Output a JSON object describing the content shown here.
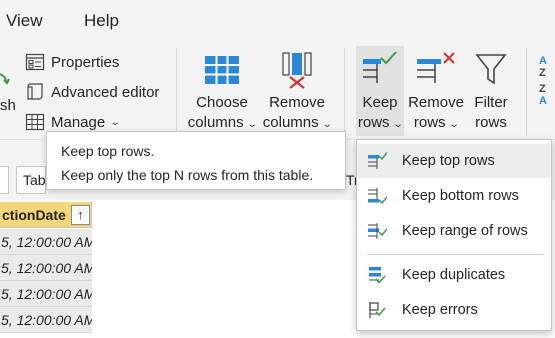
{
  "menu": {
    "view": "View",
    "help": "Help"
  },
  "ribbon": {
    "refresh_partial": "sh",
    "properties": "Properties",
    "advanced_editor": "Advanced editor",
    "manage": "Manage",
    "choose_columns": {
      "line1": "Choose",
      "line2": "columns"
    },
    "remove_columns": {
      "line1": "Remove",
      "line2": "columns"
    },
    "keep_rows": {
      "line1": "Keep",
      "line2": "rows"
    },
    "remove_rows": {
      "line1": "Remove",
      "line2": "rows"
    },
    "filter_rows": {
      "line1": "Filter",
      "line2": "rows"
    }
  },
  "editor": {
    "table_field_partial": "Tab",
    "partial_right": "Tr"
  },
  "grid": {
    "column_header": "ctionDate",
    "sort_glyph": "↑",
    "rows": [
      "5, 12:00:00 AM",
      "5, 12:00:00 AM",
      "5, 12:00:00 AM",
      "5, 12:00:00 AM"
    ]
  },
  "tooltip": {
    "title": "Keep top rows.",
    "description": "Keep only the top N rows from this table."
  },
  "dropdown": {
    "items": [
      {
        "label": "Keep top rows",
        "icon": "keep-top-rows-icon"
      },
      {
        "label": "Keep bottom rows",
        "icon": "keep-bottom-rows-icon"
      },
      {
        "label": "Keep range of rows",
        "icon": "keep-range-rows-icon"
      },
      {
        "label": "Keep duplicates",
        "icon": "keep-duplicates-icon"
      },
      {
        "label": "Keep errors",
        "icon": "keep-errors-icon"
      }
    ]
  },
  "colors": {
    "accent_blue": "#2b88d8",
    "check_green": "#3a9b4a",
    "remove_red": "#d13438",
    "header_yellow": "#f5d77a"
  }
}
